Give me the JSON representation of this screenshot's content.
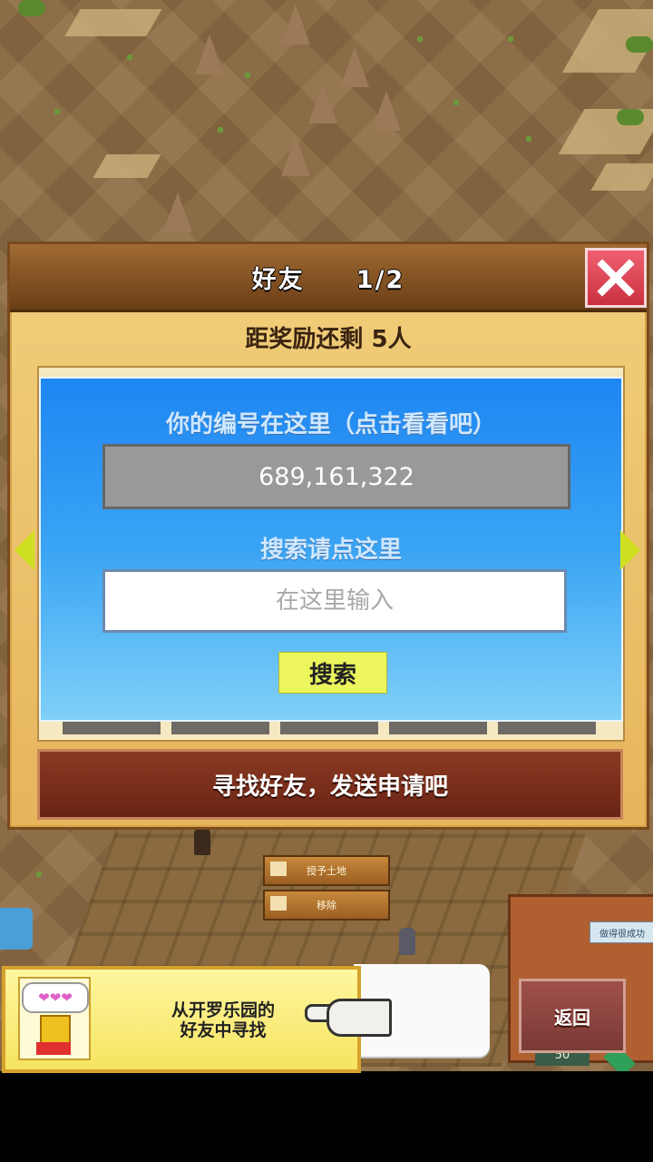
{
  "friends_panel": {
    "title": "好友",
    "page_indicator": "1/2",
    "reward_text": "距奖励还剩 5人",
    "id_label": "你的编号在这里（点击看看吧）",
    "id_value": "689,161,322",
    "search_label": "搜索请点这里",
    "search_placeholder": "在这里输入",
    "search_button": "搜索",
    "find_friends_button": "寻找好友，发送申请吧"
  },
  "field_menu": {
    "grant_land": "授予土地",
    "remove": "移除"
  },
  "status_tag": "做得很成功",
  "kairo_banner": {
    "hearts": "❤❤❤",
    "line1": "从开罗乐园的",
    "line2": "好友中寻找"
  },
  "back_button": "返回",
  "corner_value": "50",
  "colors": {
    "panel_bg": "#e6b55d",
    "blue_box": "#1e86f2",
    "search_button": "#ecf55c",
    "find_button": "#6a2414",
    "close_button": "#c93040"
  }
}
